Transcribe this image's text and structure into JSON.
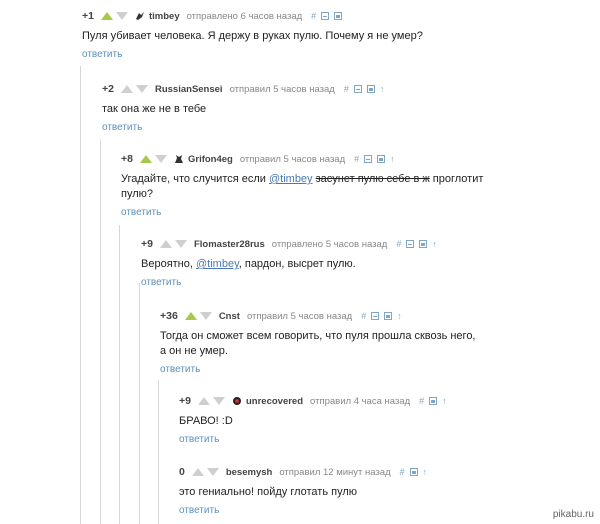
{
  "comments": [
    {
      "rating": "+1",
      "author": "timbey",
      "status": "отправлено 6 часов назад",
      "text_parts": [
        "Пуля убивает человека. Я держу в руках пулю. Почему я не умер?"
      ],
      "reply_label": "ответить",
      "up_active": true,
      "avatar": "bird-avatar-icon"
    },
    {
      "rating": "+2",
      "author": "RussianSensei",
      "status": "отправил 5 часов назад",
      "text_parts": [
        "так она же не в тебе"
      ],
      "reply_label": "ответить",
      "up_active": false,
      "avatar": ""
    },
    {
      "rating": "+8",
      "author": "Grifon4eg",
      "status": "отправил 5 часов назад",
      "text_parts": [
        "Угадайте, что случится если ",
        "@timbey",
        " ",
        "засунет пулю себе в ж",
        " проглотит",
        "пулю?"
      ],
      "reply_label": "ответить",
      "up_active": true,
      "avatar": "griffin-avatar-icon"
    },
    {
      "rating": "+9",
      "author": "Flomaster28rus",
      "status": "отправлено 5 часов назад",
      "text_parts": [
        "Вероятно, ",
        "@timbey",
        ", пардон, высрет пулю."
      ],
      "reply_label": "ответить",
      "up_active": false,
      "avatar": ""
    },
    {
      "rating": "+36",
      "author": "Cnst",
      "status": "отправил 5 часов назад",
      "text_parts": [
        "Тогда он сможет всем говорить, что пуля прошла сквозь него,",
        "а он не умер."
      ],
      "reply_label": "ответить",
      "up_active": true,
      "avatar": ""
    },
    {
      "rating": "+9",
      "author": "unrecovered",
      "status": "отправил 4 часа назад",
      "text_parts": [
        "БРАВО! :D"
      ],
      "reply_label": "ответить",
      "up_active": false,
      "avatar": "red-skull-avatar-icon"
    },
    {
      "rating": "0",
      "author": "besemysh",
      "status": "отправил 12 минут назад",
      "text_parts": [
        "это гениально! пойду глотать пулю"
      ],
      "reply_label": "ответить",
      "up_active": false,
      "avatar": ""
    }
  ],
  "action_icons": [
    "link-hash-icon",
    "collapse-icon",
    "save-icon",
    "parent-arrow-icon"
  ],
  "watermark": "pikabu.ru",
  "colors": {
    "upvote_active": "#a6c94a",
    "vote_inactive": "#cfcfcf",
    "link": "#5c8fbb",
    "thread_line": "#d6d6d6"
  }
}
